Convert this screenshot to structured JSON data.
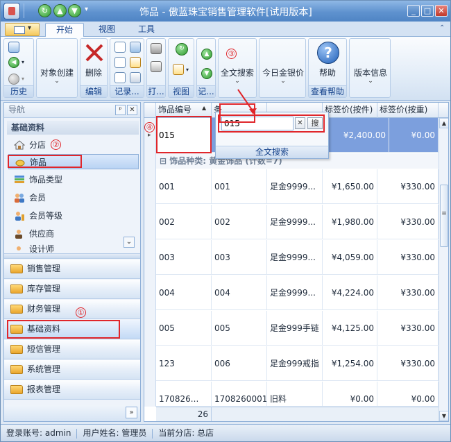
{
  "window": {
    "title": "饰品 - 傲蓝珠宝销售管理软件[试用版本]",
    "buttons": {
      "minimize": "_",
      "maximize": "□",
      "close": "✕"
    },
    "quick_access": {
      "refresh": "↻",
      "up": "▲",
      "down": "▼",
      "more": "▾"
    }
  },
  "ribbon": {
    "tabs": [
      "开始",
      "视图",
      "工具"
    ],
    "active_tab": "开始",
    "groups": {
      "history": "历史",
      "object_create": "对象创建",
      "edit": "编辑",
      "delete": "删除",
      "records": "记录...",
      "print": "打...",
      "view": "视图",
      "rec2": "记...",
      "full_search": "全文搜索",
      "gold_price": "今日金银价",
      "help": "帮助",
      "help_group": "查看帮助",
      "version": "版本信息"
    }
  },
  "nav": {
    "header": "导航",
    "pin": "ᵖ",
    "close": "✕",
    "section": "基础资料",
    "items": [
      "分店",
      "饰品",
      "饰品类型",
      "会员",
      "会员等级",
      "供应商",
      "设计师"
    ],
    "selected_item": "饰品",
    "modules": [
      "销售管理",
      "库存管理",
      "财务管理",
      "基础资料",
      "短信管理",
      "系统管理",
      "报表管理"
    ],
    "selected_module": "基础资料",
    "more": "»",
    "scroll_down": "⌄"
  },
  "grid": {
    "headers": [
      "饰品编号",
      "条",
      "",
      "标签价(按件)",
      "标签价(按重)"
    ],
    "highlight_row": {
      "code": "015",
      "price_piece": "¥2,400.00",
      "price_weight": "¥0.00"
    },
    "group_caption": "饰品种类: 黄金饰品 (计数=7)",
    "group_toggle": "⊟",
    "rows": [
      {
        "code": "001",
        "barcode": "001",
        "name": "足金9999...",
        "price_piece": "¥1,650.00",
        "price_weight": "¥330.00"
      },
      {
        "code": "002",
        "barcode": "002",
        "name": "足金9999...",
        "price_piece": "¥1,980.00",
        "price_weight": "¥330.00"
      },
      {
        "code": "003",
        "barcode": "003",
        "name": "足金9999...",
        "price_piece": "¥4,059.00",
        "price_weight": "¥330.00"
      },
      {
        "code": "004",
        "barcode": "004",
        "name": "足金9999...",
        "price_piece": "¥4,224.00",
        "price_weight": "¥330.00"
      },
      {
        "code": "005",
        "barcode": "005",
        "name": "足金999手链",
        "price_piece": "¥4,125.00",
        "price_weight": "¥330.00"
      },
      {
        "code": "123",
        "barcode": "006",
        "name": "足金999戒指",
        "price_piece": "¥1,254.00",
        "price_weight": "¥330.00"
      },
      {
        "code": "170826...",
        "barcode": "1708260001",
        "name": "旧料",
        "price_piece": "¥0.00",
        "price_weight": "¥0.00"
      }
    ],
    "footer_count": "26",
    "scroll": {
      "up": "▲",
      "down": "▼",
      "grip": "≡"
    },
    "row_indicator": "▸"
  },
  "search_popup": {
    "value": "015",
    "clear": "✕",
    "go": "搜",
    "label": "全文搜索"
  },
  "annotations": [
    "①",
    "②",
    "③",
    "④"
  ],
  "status": {
    "account": "登录账号: admin",
    "user": "用户姓名: 管理员",
    "branch": "当前分店: 总店"
  },
  "colors": {
    "annotation": "#e0262b",
    "highlight_row": "#7c9fdd",
    "accent": "#15428b"
  }
}
